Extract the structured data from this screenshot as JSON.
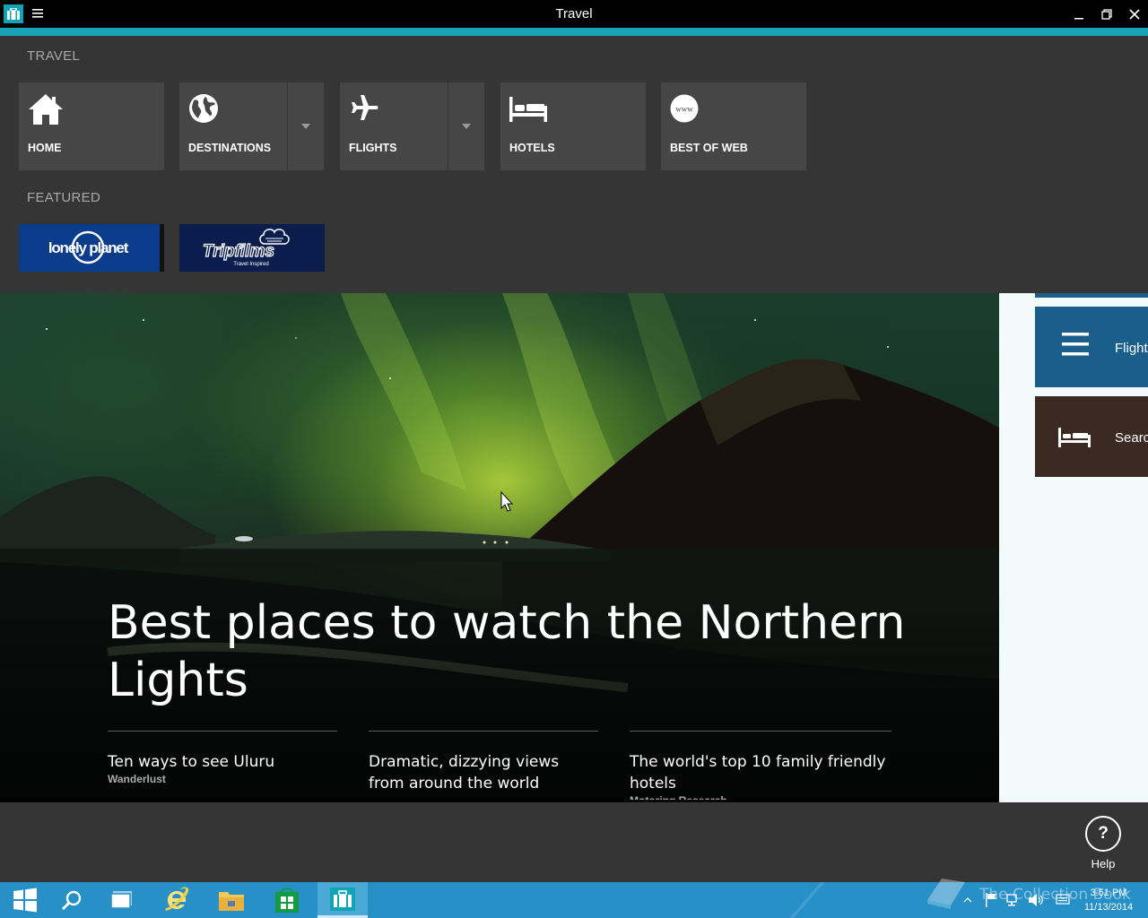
{
  "window": {
    "title": "Travel"
  },
  "nav": {
    "section_label": "TRAVEL",
    "tiles": [
      {
        "label": "HOME",
        "icon": "home-icon"
      },
      {
        "label": "DESTINATIONS",
        "icon": "globe-icon"
      },
      {
        "label": "FLIGHTS",
        "icon": "airplane-icon"
      },
      {
        "label": "HOTELS",
        "icon": "bed-icon"
      },
      {
        "label": "BEST OF WEB",
        "icon": "www-icon"
      }
    ],
    "featured_label": "FEATURED",
    "featured": [
      {
        "logo_text": "lonely planet",
        "color": "#0b3c8c"
      },
      {
        "logo_text": "Tripfilms",
        "logo_subtext": "Travel Inspired",
        "color": "#0b1d4d"
      }
    ]
  },
  "hero": {
    "title": "Best places to watch the Northern Lights",
    "stories": [
      {
        "title": "Ten ways to see Uluru",
        "source": "Wanderlust"
      },
      {
        "title": "Dramatic, dizzying views from around the world",
        "source": ""
      },
      {
        "title": "The world's top 10 family friendly hotels",
        "source": "Motoring Research"
      }
    ]
  },
  "right_panel": {
    "cards": [
      {
        "label": "Flight",
        "icon": "list-icon",
        "color": "#1a5f8c"
      },
      {
        "label": "Searc",
        "icon": "bed-icon",
        "color": "#3a2a22"
      }
    ]
  },
  "appbar": {
    "help_glyph": "?",
    "help_label": "Help"
  },
  "taskbar": {
    "time": "3:51 PM",
    "date": "11/13/2014",
    "watermark": "The Collection Book",
    "items": [
      "start-icon",
      "search-icon",
      "task-view-icon",
      "internet-explorer-icon",
      "file-explorer-icon",
      "store-icon",
      "travel-app-icon"
    ]
  },
  "colors": {
    "accent": "#1aa2b5",
    "nav_background": "#353535",
    "tile_background": "#464646",
    "taskbar": "#2690c7"
  }
}
